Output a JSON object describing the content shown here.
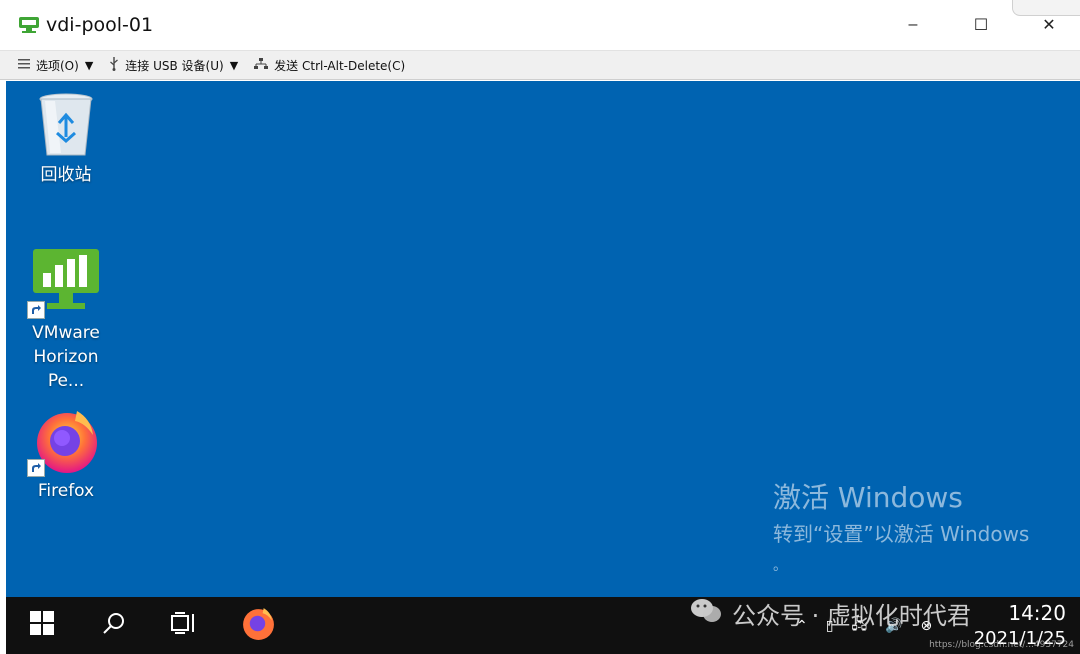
{
  "window": {
    "title": "vdi-pool-01",
    "controls": {
      "minimize": "–",
      "maximize": "☐",
      "close": "✕"
    }
  },
  "toolbar": {
    "options_label": "选项(O)",
    "usb_label": "连接 USB 设备(U)",
    "cad_label": "发送 Ctrl-Alt-Delete(C)",
    "icons": [
      "menu-icon",
      "usb-icon",
      "network-icon"
    ]
  },
  "desktop": {
    "background_color": "#0063b1",
    "icons": [
      {
        "label": "回收站",
        "icon": "recycle-bin-icon"
      },
      {
        "label": "VMware Horizon Pe...",
        "label_line1": "VMware",
        "label_line2": "Horizon Pe...",
        "icon": "vmware-horizon-icon"
      },
      {
        "label": "Firefox",
        "icon": "firefox-icon"
      }
    ],
    "activation": {
      "title": "激活 Windows",
      "line2": "转到“设置”以激活 Windows",
      "line3": "。"
    }
  },
  "taskbar": {
    "items": [
      "windows-start-icon",
      "search-icon",
      "task-view-icon",
      "firefox-icon"
    ],
    "tray_icons": [
      "chevron-up-icon",
      "usb-device-icon",
      "network-icon",
      "volume-icon",
      "disconnect-icon"
    ],
    "time": "14:20",
    "date": "2021/1/25"
  },
  "watermark": {
    "text": "公众号 · 虚拟化时代君",
    "url": "https://blog.csdn.net/...4937724"
  },
  "colors": {
    "accent": "#0063b1",
    "taskbar": "#101010",
    "toolbar": "#f0f0f0"
  }
}
